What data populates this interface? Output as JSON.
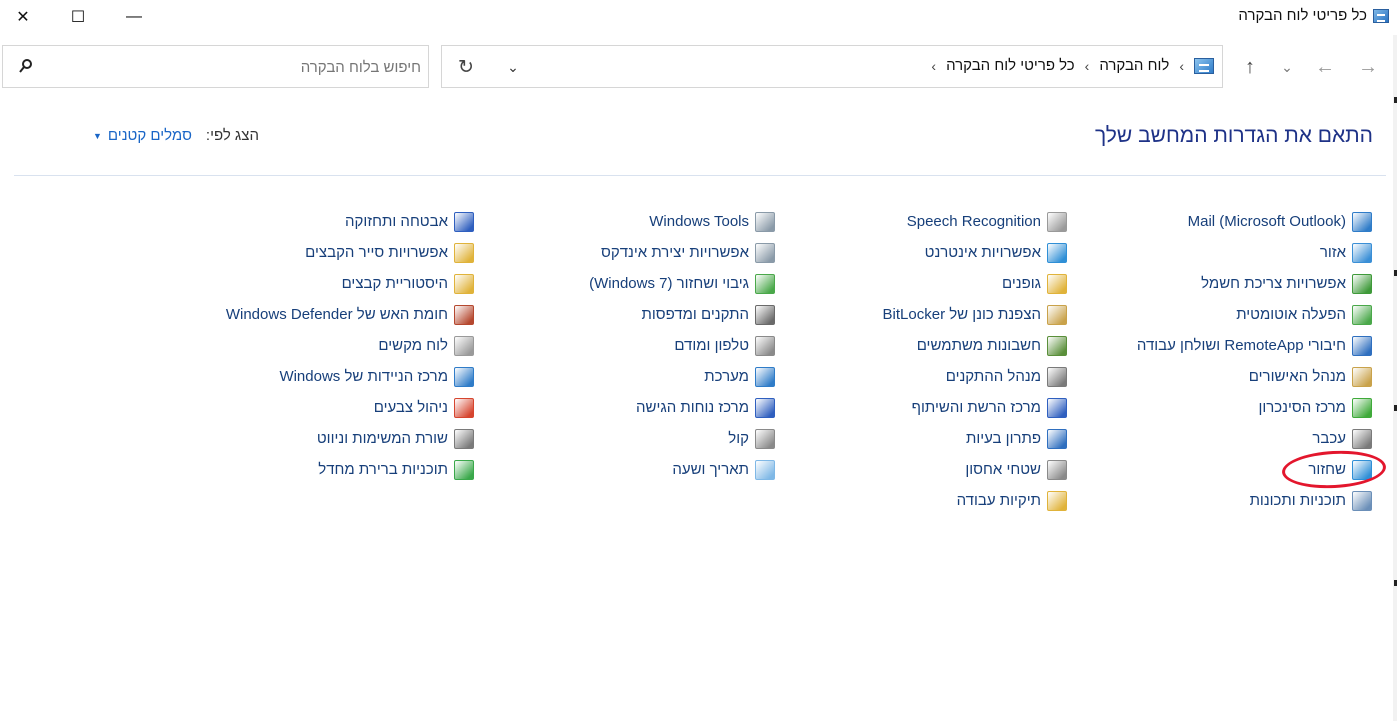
{
  "window": {
    "title": "כל פריטי לוח הבקרה",
    "controls": {
      "close": "✕",
      "maximize": "☐",
      "minimize": "—"
    }
  },
  "nav": {
    "forward": "→",
    "back": "←",
    "recent": "⌄",
    "up": "↑"
  },
  "address": {
    "crumbs": [
      "לוח הבקרה",
      "כל פריטי לוח הבקרה"
    ],
    "separator": "›",
    "trailing_separator": "›",
    "dropdown": "⌄",
    "refresh": "↻"
  },
  "search": {
    "placeholder": "חיפוש בלוח הבקרה",
    "value": ""
  },
  "header": {
    "title": "התאם את הגדרות המחשב שלך",
    "view_by_label": "הצג לפי:",
    "view_by_value": "סמלים קטנים",
    "caret": "▼"
  },
  "columns": [
    [
      {
        "label": "Mail (Microsoft Outlook)",
        "icon": "mail-icon",
        "color": "#2f7cc8"
      },
      {
        "label": "אזור",
        "icon": "region-globe-icon",
        "color": "#3a8fd6"
      },
      {
        "label": "אפשרויות צריכת חשמל",
        "icon": "power-options-icon",
        "color": "#3f9a3a"
      },
      {
        "label": "הפעלה אוטומטית",
        "icon": "autoplay-icon",
        "color": "#4aa84a"
      },
      {
        "label": "חיבורי RemoteApp ושולחן עבודה",
        "icon": "remoteapp-icon",
        "color": "#2f6fbf"
      },
      {
        "label": "מנהל האישורים",
        "icon": "credential-manager-icon",
        "color": "#c9a24a"
      },
      {
        "label": "מרכז הסינכרון",
        "icon": "sync-center-icon",
        "color": "#3faa3a"
      },
      {
        "label": "עכבר",
        "icon": "mouse-icon",
        "color": "#7a7a7a"
      },
      {
        "label": "שחזור",
        "icon": "recovery-icon",
        "color": "#2f8fd6"
      },
      {
        "label": "תוכניות ותכונות",
        "icon": "programs-features-icon",
        "color": "#6b8fb8"
      }
    ],
    [
      {
        "label": "Speech Recognition",
        "icon": "microphone-icon",
        "color": "#9a9a9a"
      },
      {
        "label": "אפשרויות אינטרנט",
        "icon": "internet-options-icon",
        "color": "#2f8fd6"
      },
      {
        "label": "גופנים",
        "icon": "fonts-icon",
        "color": "#e0b33a"
      },
      {
        "label": "הצפנת כונן של BitLocker",
        "icon": "bitlocker-key-icon",
        "color": "#c9a24a"
      },
      {
        "label": "חשבונות משתמשים",
        "icon": "user-accounts-icon",
        "color": "#5a8f3a"
      },
      {
        "label": "מנהל ההתקנים",
        "icon": "device-manager-icon",
        "color": "#7a7a7a"
      },
      {
        "label": "מרכז הרשת והשיתוף",
        "icon": "network-center-icon",
        "color": "#2f5fbf"
      },
      {
        "label": "פתרון בעיות",
        "icon": "troubleshooting-icon",
        "color": "#2f6fbf"
      },
      {
        "label": "שטחי אחסון",
        "icon": "storage-spaces-icon",
        "color": "#8a8a8a"
      },
      {
        "label": "תיקיות עבודה",
        "icon": "work-folders-icon",
        "color": "#e0b33a"
      }
    ],
    [
      {
        "label": "Windows Tools",
        "icon": "windows-tools-icon",
        "color": "#8a9aa8"
      },
      {
        "label": "אפשרויות יצירת אינדקס",
        "icon": "indexing-options-icon",
        "color": "#8a9aa8"
      },
      {
        "label": "גיבוי ושחזור (Windows 7)",
        "icon": "backup-restore-icon",
        "color": "#4aa84a"
      },
      {
        "label": "התקנים ומדפסות",
        "icon": "devices-printers-icon",
        "color": "#6a6a6a"
      },
      {
        "label": "טלפון ומודם",
        "icon": "phone-modem-icon",
        "color": "#8a8a8a"
      },
      {
        "label": "מערכת",
        "icon": "system-icon",
        "color": "#2f7cc8"
      },
      {
        "label": "מרכז נוחות הגישה",
        "icon": "ease-of-access-icon",
        "color": "#2f5fbf"
      },
      {
        "label": "קול",
        "icon": "sound-icon",
        "color": "#8a8a8a"
      },
      {
        "label": "תאריך ושעה",
        "icon": "date-time-icon",
        "color": "#7fb8e6"
      }
    ],
    [
      {
        "label": "אבטחה ותחזוקה",
        "icon": "security-flag-icon",
        "color": "#2f5fbf"
      },
      {
        "label": "אפשרויות סייר הקבצים",
        "icon": "file-explorer-options-icon",
        "color": "#e0b33a"
      },
      {
        "label": "היסטוריית קבצים",
        "icon": "file-history-icon",
        "color": "#e0b33a"
      },
      {
        "label": "חומת האש של Windows Defender",
        "icon": "firewall-icon",
        "color": "#b5482f"
      },
      {
        "label": "לוח מקשים",
        "icon": "keyboard-icon",
        "color": "#9a9a9a"
      },
      {
        "label": "מרכז הניידות של Windows",
        "icon": "mobility-center-icon",
        "color": "#2f7cc8"
      },
      {
        "label": "ניהול צבעים",
        "icon": "color-management-icon",
        "color": "#d6452f"
      },
      {
        "label": "שורת המשימות וניווט",
        "icon": "taskbar-navigation-icon",
        "color": "#7a7a7a"
      },
      {
        "label": "תוכניות ברירת מחדל",
        "icon": "default-programs-icon",
        "color": "#3aa84a"
      }
    ]
  ]
}
